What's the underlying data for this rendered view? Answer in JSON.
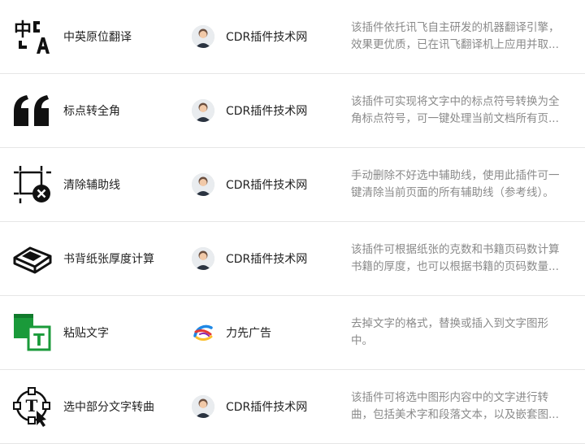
{
  "plugins": [
    {
      "name": "中英原位翻译",
      "author": "CDR插件技术网",
      "avatar": "person-avatar",
      "icon": "translate-icon",
      "desc": "该插件依托讯飞自主研发的机器翻译引擎，效果更优质，已在讯飞翻译机上应用并取..."
    },
    {
      "name": "标点转全角",
      "author": "CDR插件技术网",
      "avatar": "person-avatar",
      "icon": "quote-icon",
      "desc": "该插件可实现将文字中的标点符号转换为全角标点符号，可一键处理当前文档所有页..."
    },
    {
      "name": "清除辅助线",
      "author": "CDR插件技术网",
      "avatar": "person-avatar",
      "icon": "clear-guides-icon",
      "desc": "手动删除不好选中辅助线，使用此插件可一键清除当前页面的所有辅助线（参考线）。"
    },
    {
      "name": "书背纸张厚度计算",
      "author": "CDR插件技术网",
      "avatar": "person-avatar",
      "icon": "book-icon",
      "desc": "该插件可根据纸张的克数和书籍页码数计算书籍的厚度，也可以根据书籍的页码数量..."
    },
    {
      "name": "粘贴文字",
      "author": "力先广告",
      "avatar": "brand-logo-avatar",
      "icon": "paste-text-icon",
      "desc": "去掉文字的格式，替换或插入到文字图形中。"
    },
    {
      "name": "选中部分文字转曲",
      "author": "CDR插件技术网",
      "avatar": "person-avatar",
      "icon": "text-to-curve-icon",
      "desc": "该插件可将选中图形内容中的文字进行转曲，包括美术字和段落文本，以及嵌套图..."
    }
  ],
  "colors": {
    "text": "#222222",
    "muted": "#8a8a8a",
    "divider": "#e6e6e6",
    "green": "#1a9a3a"
  }
}
